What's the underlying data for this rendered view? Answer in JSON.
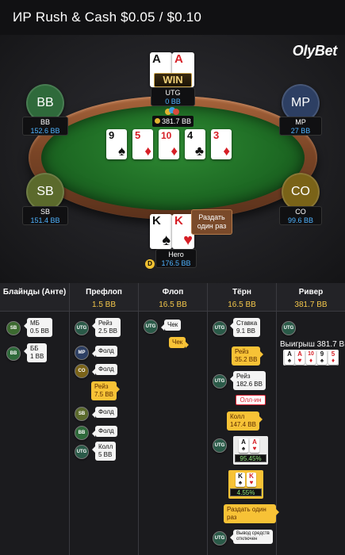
{
  "window": {
    "title": "ИР  Rush & Cash $0.05 / $0.10",
    "brand": "OlyBet"
  },
  "table": {
    "pot": "381.7 BB",
    "win_badge": "WIN",
    "runout_button": "Раздать один раз",
    "dealer_button": "D",
    "board": [
      {
        "rank": "9",
        "suit": "♠",
        "color": "blk"
      },
      {
        "rank": "5",
        "suit": "♦",
        "color": "red"
      },
      {
        "rank": "10",
        "suit": "♦",
        "color": "red"
      },
      {
        "rank": "4",
        "suit": "♣",
        "color": "blk"
      },
      {
        "rank": "3",
        "suit": "♦",
        "color": "red"
      }
    ],
    "seats": {
      "utg": {
        "name": "UTG",
        "stack": "0 BB",
        "cards": [
          {
            "rank": "A",
            "suit": "♠"
          },
          {
            "rank": "A",
            "suit": "♥"
          }
        ]
      },
      "bb": {
        "label": "BB",
        "name": "BB",
        "stack": "152.6 BB",
        "color": "#2f6a3b"
      },
      "mp": {
        "label": "MP",
        "name": "MP",
        "stack": "27 BB",
        "color": "#2d3f63"
      },
      "sb": {
        "label": "SB",
        "name": "SB",
        "stack": "151.4 BB",
        "color": "#5b6a2c"
      },
      "co": {
        "label": "CO",
        "name": "CO",
        "stack": "99.6 BB",
        "color": "#7a6318"
      },
      "hero": {
        "name": "Hero",
        "stack": "176.5 BB",
        "cards": [
          {
            "rank": "K",
            "suit": "♠"
          },
          {
            "rank": "K",
            "suit": "♥"
          }
        ]
      }
    }
  },
  "history": {
    "columns": [
      {
        "title": "Блайнды (Анте)",
        "pot": ""
      },
      {
        "title": "Префлоп",
        "pot": "1.5 BB"
      },
      {
        "title": "Флоп",
        "pot": "16.5 BB"
      },
      {
        "title": "Тёрн",
        "pot": "16.5 BB"
      },
      {
        "title": "Ривер",
        "pot": "381.7 BB"
      }
    ],
    "blinds": [
      {
        "pos": "SB",
        "text1": "МБ",
        "text2": "0.5 BB"
      },
      {
        "pos": "BB",
        "text1": "ББ",
        "text2": "1 BB"
      }
    ],
    "preflop": [
      {
        "pos": "UTG",
        "text1": "Рейз",
        "text2": "2.5 BB"
      },
      {
        "pos": "MP",
        "text1": "Фолд",
        "text2": ""
      },
      {
        "pos": "CO",
        "text1": "Фолд",
        "text2": ""
      },
      {
        "pos": "",
        "text1": "Рейз",
        "text2": "7.5 BB"
      },
      {
        "pos": "SB",
        "text1": "Фолд",
        "text2": ""
      },
      {
        "pos": "BB",
        "text1": "Фолд",
        "text2": ""
      },
      {
        "pos": "UTG",
        "text1": "Колл",
        "text2": "5 BB"
      }
    ],
    "flop": [
      {
        "pos": "UTG",
        "text1": "Чек",
        "text2": ""
      },
      {
        "pos": "",
        "text1": "Чек",
        "text2": ""
      }
    ],
    "turn": [
      {
        "pos": "UTG",
        "text1": "Ставка",
        "text2": "9.1 BB"
      },
      {
        "pos": "",
        "text1": "Рейз",
        "text2": "35.2 BB"
      },
      {
        "pos": "UTG",
        "text1": "Рейз",
        "text2": "182.6 BB"
      },
      {
        "pos": "",
        "text1": "Олл-ин",
        "text2": ""
      },
      {
        "pos": "",
        "text1": "Колл",
        "text2": "147.4 BB"
      },
      {
        "pos": "UTG",
        "text1": "",
        "text2": ""
      },
      {
        "pos": "",
        "text1": "Раздать один раз",
        "text2": ""
      },
      {
        "pos": "UTG",
        "text1": "Вывод средств отключен",
        "text2": ""
      }
    ],
    "equity": {
      "utg": "95.45%",
      "hero": "4.55%"
    },
    "river": {
      "pos": "UTG",
      "text": "Выигрыш 381.7 BB",
      "cards": [
        {
          "rank": "A",
          "suit": "♠",
          "color": "blk"
        },
        {
          "rank": "A",
          "suit": "♥",
          "color": "red"
        },
        {
          "rank": "10",
          "suit": "♦",
          "color": "red"
        },
        {
          "rank": "9",
          "suit": "♠",
          "color": "blk"
        },
        {
          "rank": "5",
          "suit": "♦",
          "color": "red"
        }
      ]
    }
  }
}
